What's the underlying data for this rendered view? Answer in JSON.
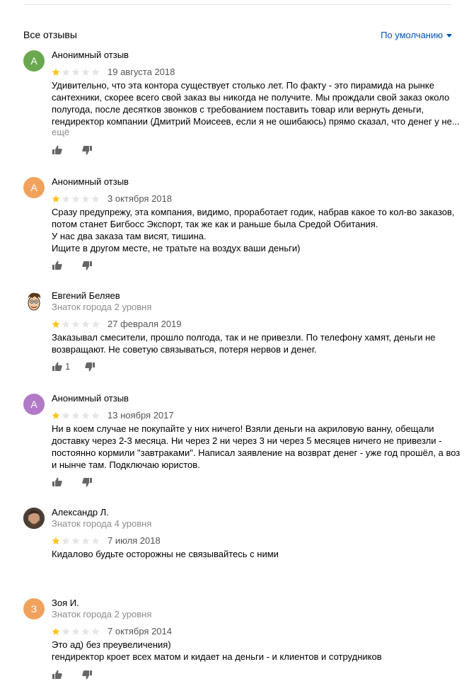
{
  "header": {
    "title": "Все отзывы",
    "sort_label": "По умолчанию"
  },
  "colors": {
    "link": "#0055b3",
    "star_filled": "#fcc419",
    "star_empty": "#e5e5e5",
    "avatar_green": "#6aa84f",
    "avatar_orange": "#f0a25c",
    "avatar_purple": "#b279c6"
  },
  "reviews": [
    {
      "avatar_letter": "А",
      "name": "Анонимный отзыв",
      "level": "",
      "rating": 1,
      "date": "19 августа 2018",
      "lines": [
        "Удивительно, что эта контора существует столько лет. По факту - это пирамида на рынке",
        "сантехники, скорее всего свой заказ вы никогда не получите. Мы прождали свой заказ около",
        "полугода, после десятков звонков с требованием поставить товар или вернуть деньги,",
        "гендиректор компании (Дмитрий Моисеев, если я не ошибаюсь) прямо сказал, что денег у не..."
      ],
      "more": "ещё",
      "likes": ""
    },
    {
      "avatar_letter": "А",
      "name": "Анонимный отзыв",
      "level": "",
      "rating": 1,
      "date": "3 октября 2018",
      "lines": [
        "Сразу предупрежу, эта компания, видимо, проработает годик, набрав какое то кол-во заказов,",
        "потом станет Бигбосс Экспорт, так же как и раньше была Средой Обитания.",
        "У нас два заказа там висят, тишина.",
        "Ищите в другом месте, не тратьте на воздух ваши деньги)"
      ],
      "more": "",
      "likes": ""
    },
    {
      "avatar_letter": "",
      "name": "Евгений Беляев",
      "level": "Знаток города 2 уровня",
      "rating": 1,
      "date": "27 февраля 2019",
      "lines": [
        "Заказывал смесители, прошло полгода, так и не привезли. По телефону хамят, деньги не",
        "возвращают. Не советую связываться, потеря нервов и денег."
      ],
      "more": "",
      "likes": "1"
    },
    {
      "avatar_letter": "А",
      "name": "Анонимный отзыв",
      "level": "",
      "rating": 1,
      "date": "13 ноября 2017",
      "lines": [
        "Ни в коем случае не покупайте у них ничего! Взяли деньги на акриловую ванну, обещали",
        "доставку через 2-3 месяца. Ни через 2 ни через 3 ни через 5 месяцев ничего не привезли -",
        "постоянно кормили \"завтраками\". Написал заявление на возврат денег - уже год прошёл, а воз",
        "и нынче там. Подключаю юристов."
      ],
      "more": "",
      "likes": ""
    },
    {
      "avatar_letter": "",
      "name": "Александр Л.",
      "level": "Знаток города 4 уровня",
      "rating": 1,
      "date": "7 июля 2018",
      "lines": [
        "Кидалово будьте осторожны не связывайтесь с ними"
      ],
      "more": "",
      "likes": ""
    },
    {
      "avatar_letter": "З",
      "name": "Зоя И.",
      "level": "Знаток города 2 уровня",
      "rating": 1,
      "date": "7 октября 2014",
      "lines": [
        "Это ад) без преувеличения)",
        "гендиректор кроет всех матом и кидает на деньги - и клиентов и сотрудников"
      ],
      "more": "",
      "likes": ""
    }
  ]
}
